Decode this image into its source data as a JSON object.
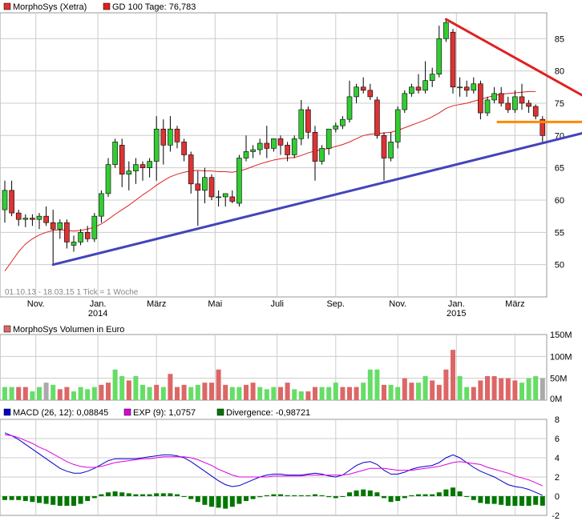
{
  "colors": {
    "up": "#33cc33",
    "down": "#dd3333",
    "gd": "#e02020",
    "blue_trend": "#4444bb",
    "red_trend": "#e02020",
    "orange_line": "#ff8800",
    "macd": "#0000cc",
    "exp": "#dd00dd",
    "divergence": "#007700",
    "vol_up": "#66dd66",
    "vol_down": "#dd6666",
    "vol_neutral": "#aaaaaa",
    "grid": "#cccccc"
  },
  "chart_data": [
    {
      "type": "candlestick",
      "legend": [
        {
          "label": "MorphoSys (Xetra)",
          "color_key": "down"
        },
        {
          "label": "GD 100 Tage: 76,783",
          "color_key": "gd"
        }
      ],
      "info_text": "01.10.13 - 18.03.15   1 Tick = 1 Woche",
      "ylim": [
        45,
        89
      ],
      "y_ticks": [
        50,
        55,
        60,
        65,
        70,
        75,
        80,
        85
      ],
      "x_ticks": [
        {
          "label": "Nov.",
          "week": 4.5,
          "year": ""
        },
        {
          "label": "Jan.",
          "week": 13.5,
          "year": "2014"
        },
        {
          "label": "März",
          "week": 22,
          "year": ""
        },
        {
          "label": "Mai",
          "week": 30.5,
          "year": ""
        },
        {
          "label": "Juli",
          "week": 39.5,
          "year": ""
        },
        {
          "label": "Sep.",
          "week": 48,
          "year": ""
        },
        {
          "label": "Nov.",
          "week": 57,
          "year": ""
        },
        {
          "label": "Jan.",
          "week": 65.5,
          "year": "2015"
        },
        {
          "label": "März",
          "week": 74,
          "year": ""
        }
      ],
      "candles": [
        [
          58.5,
          63.0,
          56.5,
          61.5
        ],
        [
          61.5,
          63.0,
          57.5,
          58.0
        ],
        [
          58.0,
          58.5,
          56.0,
          57.0
        ],
        [
          57.0,
          57.8,
          55.8,
          57.2
        ],
        [
          57.2,
          57.8,
          56.0,
          57.0
        ],
        [
          57.0,
          58.0,
          55.5,
          57.5
        ],
        [
          57.5,
          59.0,
          56.0,
          56.5
        ],
        [
          56.5,
          58.5,
          50.0,
          55.5
        ],
        [
          55.5,
          57.0,
          54.0,
          56.5
        ],
        [
          56.5,
          57.0,
          52.5,
          53.5
        ],
        [
          53.0,
          54.5,
          52.0,
          53.5
        ],
        [
          53.5,
          55.5,
          53.0,
          55.0
        ],
        [
          55.0,
          56.0,
          53.5,
          54.0
        ],
        [
          54.0,
          58.0,
          53.5,
          57.5
        ],
        [
          57.5,
          61.5,
          56.5,
          61.0
        ],
        [
          61.0,
          66.5,
          60.5,
          65.5
        ],
        [
          65.5,
          69.5,
          65.0,
          69.0
        ],
        [
          68.5,
          69.5,
          62.0,
          64.0
        ],
        [
          64.0,
          66.0,
          61.5,
          64.5
        ],
        [
          64.5,
          66.5,
          62.5,
          65.5
        ],
        [
          65.5,
          66.0,
          63.0,
          65.0
        ],
        [
          65.0,
          66.5,
          63.5,
          66.0
        ],
        [
          66.0,
          73.0,
          63.0,
          71.0
        ],
        [
          71.0,
          72.5,
          65.5,
          68.5
        ],
        [
          68.5,
          73.0,
          67.5,
          71.0
        ],
        [
          71.0,
          71.5,
          68.0,
          69.0
        ],
        [
          69.0,
          69.5,
          66.0,
          67.0
        ],
        [
          67.0,
          67.5,
          61.0,
          62.5
        ],
        [
          62.5,
          64.5,
          56.0,
          61.5
        ],
        [
          61.5,
          65.0,
          59.5,
          63.5
        ],
        [
          63.5,
          64.0,
          60.0,
          60.5
        ],
        [
          60.5,
          61.5,
          59.0,
          60.5
        ],
        [
          60.5,
          61.0,
          59.0,
          61.0
        ],
        [
          60.5,
          61.5,
          59.5,
          59.8
        ],
        [
          59.5,
          67.0,
          59.0,
          66.5
        ],
        [
          66.5,
          70.0,
          66.0,
          67.5
        ],
        [
          67.5,
          68.5,
          66.5,
          67.8
        ],
        [
          67.8,
          69.5,
          67.0,
          68.8
        ],
        [
          68.8,
          71.5,
          66.5,
          68.0
        ],
        [
          68.0,
          69.5,
          67.5,
          69.5
        ],
        [
          69.5,
          70.0,
          67.0,
          68.5
        ],
        [
          68.5,
          69.0,
          66.0,
          67.0
        ],
        [
          67.0,
          70.0,
          66.5,
          69.5
        ],
        [
          69.5,
          75.5,
          68.5,
          74.0
        ],
        [
          74.0,
          74.5,
          69.5,
          70.5
        ],
        [
          70.5,
          71.5,
          63.0,
          66.0
        ],
        [
          66.0,
          68.5,
          65.5,
          68.0
        ],
        [
          68.0,
          71.0,
          67.0,
          71.0
        ],
        [
          71.0,
          72.0,
          70.5,
          71.5
        ],
        [
          71.5,
          73.0,
          71.0,
          72.5
        ],
        [
          72.5,
          78.5,
          72.0,
          76.0
        ],
        [
          76.0,
          78.0,
          75.0,
          77.5
        ],
        [
          77.5,
          79.0,
          76.5,
          77.0
        ],
        [
          77.0,
          78.0,
          75.5,
          76.0
        ],
        [
          75.5,
          76.0,
          69.5,
          70.0
        ],
        [
          70.0,
          70.5,
          63.0,
          66.5
        ],
        [
          66.5,
          70.5,
          66.0,
          69.0
        ],
        [
          69.0,
          74.5,
          68.0,
          74.0
        ],
        [
          74.0,
          77.0,
          73.5,
          76.5
        ],
        [
          76.5,
          78.0,
          76.0,
          77.5
        ],
        [
          77.5,
          79.5,
          76.5,
          77.0
        ],
        [
          77.0,
          81.5,
          76.5,
          78.5
        ],
        [
          78.5,
          80.5,
          77.5,
          79.5
        ],
        [
          79.5,
          87.0,
          79.0,
          85.0
        ],
        [
          85.0,
          88.0,
          84.5,
          87.5
        ],
        [
          86.0,
          86.5,
          76.5,
          77.5
        ],
        [
          77.5,
          79.0,
          76.0,
          77.5
        ],
        [
          77.5,
          78.5,
          76.0,
          77.0
        ],
        [
          77.0,
          79.0,
          76.5,
          78.0
        ],
        [
          78.0,
          78.5,
          72.5,
          73.5
        ],
        [
          73.5,
          76.0,
          73.0,
          75.5
        ],
        [
          75.5,
          77.5,
          75.0,
          76.5
        ],
        [
          76.5,
          77.5,
          74.5,
          75.0
        ],
        [
          75.0,
          76.0,
          73.5,
          74.0
        ],
        [
          74.0,
          77.0,
          73.5,
          76.0
        ],
        [
          76.0,
          78.0,
          74.0,
          75.0
        ],
        [
          75.0,
          75.5,
          73.5,
          74.5
        ],
        [
          74.5,
          74.8,
          72.5,
          73.0
        ],
        [
          72.5,
          73.0,
          69.0,
          70.0
        ]
      ],
      "gd100": [
        49.0,
        50.5,
        52.0,
        53.2,
        54.0,
        54.6,
        55.0,
        55.3,
        55.4,
        55.3,
        55.2,
        55.3,
        55.5,
        55.8,
        56.3,
        57.0,
        57.8,
        58.5,
        59.2,
        60.0,
        60.8,
        61.5,
        62.3,
        63.0,
        63.6,
        64.0,
        64.3,
        64.5,
        64.6,
        64.5,
        64.5,
        64.4,
        64.4,
        64.3,
        64.5,
        64.8,
        65.2,
        65.6,
        65.9,
        66.2,
        66.4,
        66.5,
        66.6,
        66.9,
        67.3,
        67.6,
        67.8,
        68.0,
        68.3,
        68.6,
        69.0,
        69.5,
        70.0,
        70.2,
        70.3,
        70.4,
        70.5,
        70.8,
        71.2,
        71.6,
        72.0,
        72.4,
        72.9,
        73.5,
        74.2,
        74.6,
        74.8,
        75.0,
        75.3,
        75.6,
        75.9,
        76.2,
        76.4,
        76.5,
        76.6,
        76.7,
        76.8,
        76.8
      ],
      "trendlines": [
        {
          "color_key": "blue_trend",
          "from": [
            7,
            50.0
          ],
          "to": [
            90,
            72.0
          ]
        },
        {
          "color_key": "red_trend",
          "from": [
            64,
            88.0
          ],
          "to": [
            90,
            72.5
          ]
        },
        {
          "color_key": "orange_line",
          "from": [
            71.5,
            72.1
          ],
          "to": [
            90,
            72.1
          ]
        }
      ]
    },
    {
      "type": "bar",
      "legend": [
        {
          "label": "MorphoSys Volumen in Euro",
          "color_key": "vol_down"
        }
      ],
      "ylim": [
        0,
        150
      ],
      "y_ticks": [
        {
          "v": 0,
          "label": "0M"
        },
        {
          "v": 50,
          "label": "50M"
        },
        {
          "v": 100,
          "label": "100M"
        },
        {
          "v": 150,
          "label": "150M"
        }
      ],
      "values": [
        30,
        30,
        30,
        30,
        20,
        30,
        40,
        35,
        25,
        30,
        20,
        30,
        25,
        30,
        35,
        40,
        70,
        55,
        45,
        55,
        35,
        30,
        35,
        30,
        60,
        30,
        35,
        30,
        35,
        40,
        40,
        70,
        35,
        30,
        30,
        35,
        40,
        30,
        25,
        30,
        30,
        40,
        25,
        20,
        20,
        30,
        30,
        30,
        40,
        30,
        30,
        30,
        40,
        70,
        70,
        35,
        35,
        30,
        50,
        40,
        40,
        55,
        45,
        35,
        70,
        115,
        55,
        30,
        30,
        45,
        55,
        55,
        50,
        50,
        45,
        40,
        50,
        55,
        50
      ],
      "dirs": "uudduuNudduuuudduuduuududdduudddduudduuudduudduuuddduuuduudduudddduuddddddduuu"
    },
    {
      "type": "line",
      "legend": [
        {
          "label": "MACD (26, 12): 0,08845",
          "color_key": "macd"
        },
        {
          "label": "EXP (9): 1,0757",
          "color_key": "exp"
        },
        {
          "label": "Divergence: -0,98721",
          "color_key": "divergence"
        }
      ],
      "ylim": [
        -2,
        8
      ],
      "y_ticks": [
        -2,
        0,
        2,
        4,
        6,
        8
      ],
      "series": [
        {
          "name": "MACD (26, 12)",
          "color_key": "macd",
          "values": [
            6.6,
            6.3,
            5.9,
            5.4,
            4.9,
            4.4,
            3.9,
            3.4,
            2.9,
            2.6,
            2.4,
            2.4,
            2.6,
            2.9,
            3.3,
            3.7,
            3.9,
            3.9,
            3.9,
            3.9,
            4.0,
            4.1,
            4.2,
            4.3,
            4.3,
            4.2,
            4.0,
            3.6,
            3.1,
            2.6,
            2.1,
            1.6,
            1.2,
            1.0,
            1.1,
            1.4,
            1.7,
            2.0,
            2.2,
            2.3,
            2.3,
            2.2,
            2.2,
            2.2,
            2.3,
            2.4,
            2.3,
            2.1,
            2.0,
            2.2,
            2.7,
            3.2,
            3.5,
            3.6,
            3.3,
            2.7,
            2.3,
            2.3,
            2.5,
            2.8,
            3.0,
            3.1,
            3.2,
            3.5,
            4.0,
            4.3,
            4.0,
            3.5,
            3.0,
            2.6,
            2.3,
            2.0,
            1.6,
            1.2,
            1.0,
            0.9,
            0.7,
            0.4,
            0.09
          ]
        },
        {
          "name": "EXP (9)",
          "color_key": "exp",
          "values": [
            6.4,
            6.3,
            6.1,
            5.8,
            5.5,
            5.1,
            4.8,
            4.4,
            4.0,
            3.6,
            3.3,
            3.1,
            3.0,
            3.0,
            3.1,
            3.3,
            3.5,
            3.6,
            3.7,
            3.8,
            3.9,
            3.9,
            4.0,
            4.1,
            4.1,
            4.1,
            4.1,
            4.0,
            3.8,
            3.5,
            3.2,
            2.8,
            2.5,
            2.2,
            2.0,
            2.0,
            2.0,
            2.0,
            2.0,
            2.1,
            2.1,
            2.1,
            2.1,
            2.1,
            2.2,
            2.2,
            2.2,
            2.2,
            2.2,
            2.2,
            2.3,
            2.5,
            2.7,
            2.9,
            2.9,
            2.9,
            2.8,
            2.7,
            2.7,
            2.7,
            2.8,
            2.9,
            3.0,
            3.1,
            3.3,
            3.5,
            3.6,
            3.5,
            3.4,
            3.3,
            3.0,
            2.8,
            2.6,
            2.4,
            2.1,
            1.9,
            1.7,
            1.4,
            1.08
          ]
        }
      ],
      "divergence": [
        -0.4,
        -0.4,
        -0.4,
        -0.5,
        -0.6,
        -0.7,
        -0.8,
        -0.9,
        -1.0,
        -1.0,
        -1.0,
        -0.8,
        -0.5,
        -0.2,
        0.2,
        0.4,
        0.5,
        0.4,
        0.3,
        0.2,
        0.2,
        0.2,
        0.3,
        0.3,
        0.3,
        0.2,
        0.0,
        -0.3,
        -0.6,
        -0.9,
        -1.1,
        -1.2,
        -1.3,
        -1.1,
        -0.8,
        -0.5,
        -0.3,
        -0.1,
        0.1,
        0.2,
        0.2,
        0.1,
        0.1,
        0.1,
        0.1,
        0.2,
        0.1,
        -0.1,
        -0.2,
        0.0,
        0.4,
        0.6,
        0.7,
        0.6,
        0.4,
        -0.2,
        -0.6,
        -0.5,
        -0.2,
        0.1,
        0.2,
        0.2,
        0.2,
        0.4,
        0.7,
        0.9,
        0.5,
        0.0,
        -0.4,
        -0.7,
        -0.8,
        -0.8,
        -0.9,
        -1.0,
        -1.0,
        -1.0,
        -1.0,
        -0.9,
        -0.99
      ]
    }
  ]
}
